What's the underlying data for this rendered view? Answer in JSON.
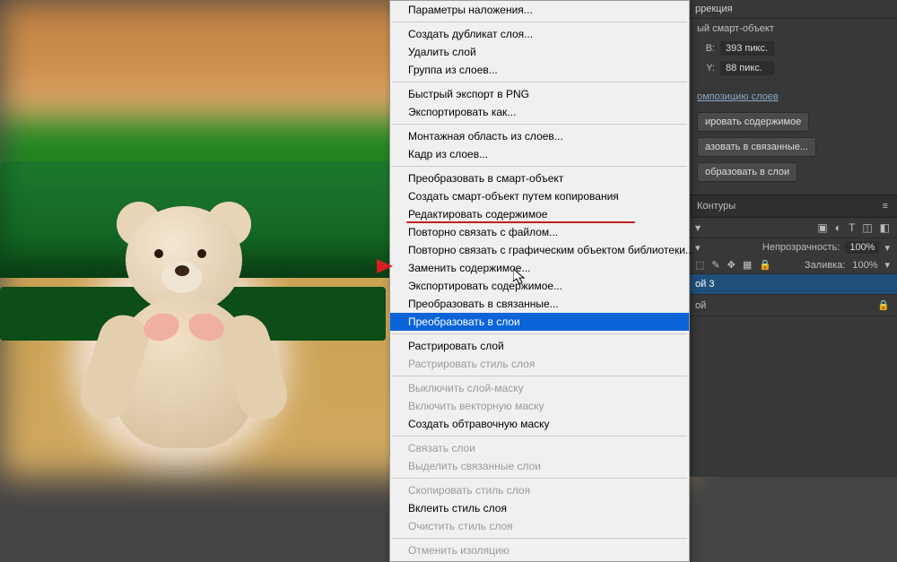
{
  "menu": {
    "items": [
      {
        "label": "Параметры наложения...",
        "disabled": false
      },
      {
        "sep": true
      },
      {
        "label": "Создать дубликат слоя...",
        "disabled": false
      },
      {
        "label": "Удалить слой",
        "disabled": false
      },
      {
        "label": "Группа из слоев...",
        "disabled": false
      },
      {
        "sep": true
      },
      {
        "label": "Быстрый экспорт в PNG",
        "disabled": false
      },
      {
        "label": "Экспортировать как...",
        "disabled": false
      },
      {
        "sep": true
      },
      {
        "label": "Монтажная область из слоев...",
        "disabled": false
      },
      {
        "label": "Кадр из слоев...",
        "disabled": false
      },
      {
        "sep": true
      },
      {
        "label": "Преобразовать в смарт-объект",
        "disabled": false
      },
      {
        "label": "Создать смарт-объект путем копирования",
        "disabled": false
      },
      {
        "label": "Редактировать содержимое",
        "disabled": false,
        "red_underline": true
      },
      {
        "label": "Повторно связать с файлом...",
        "disabled": false
      },
      {
        "label": "Повторно связать с графическим объектом библиотеки...",
        "disabled": false
      },
      {
        "label": "Заменить содержимое...",
        "disabled": false
      },
      {
        "label": "Экспортировать содержимое...",
        "disabled": false
      },
      {
        "label": "Преобразовать в связанные...",
        "disabled": false
      },
      {
        "label": "Преобразовать в слои",
        "disabled": false,
        "highlight": true
      },
      {
        "sep": true
      },
      {
        "label": "Растрировать слой",
        "disabled": false
      },
      {
        "label": "Растрировать стиль слоя",
        "disabled": true
      },
      {
        "sep": true
      },
      {
        "label": "Выключить слой-маску",
        "disabled": true
      },
      {
        "label": "Включить векторную маску",
        "disabled": true
      },
      {
        "label": "Создать обтравочную маску",
        "disabled": false
      },
      {
        "sep": true
      },
      {
        "label": "Связать слои",
        "disabled": true
      },
      {
        "label": "Выделить связанные слои",
        "disabled": true
      },
      {
        "sep": true
      },
      {
        "label": "Скопировать стиль слоя",
        "disabled": true
      },
      {
        "label": "Вклеить стиль слоя",
        "disabled": false
      },
      {
        "label": "Очистить стиль слоя",
        "disabled": true
      },
      {
        "sep": true
      },
      {
        "label": "Отменить изоляцию",
        "disabled": true
      }
    ]
  },
  "panels": {
    "correction_tab": "ррекция",
    "smart_object_label": "ый смарт-объект",
    "w_field": {
      "label": "В:",
      "value": "393 пикс."
    },
    "h_field": {
      "label": "Y:",
      "value": "88 пикс."
    },
    "compose_link": "омпозицию слоев",
    "btn_edit_content": "ировать содержимое",
    "btn_convert_linked": "азовать в связанные...",
    "btn_convert_layers": "образовать в слои",
    "contours_tab": "Контуры",
    "opacity_label": "Непрозрачность:",
    "opacity_value": "100%",
    "fill_label": "Заливка:",
    "fill_value": "100%",
    "layer3": "ой 3",
    "layer_bg": "ой"
  }
}
